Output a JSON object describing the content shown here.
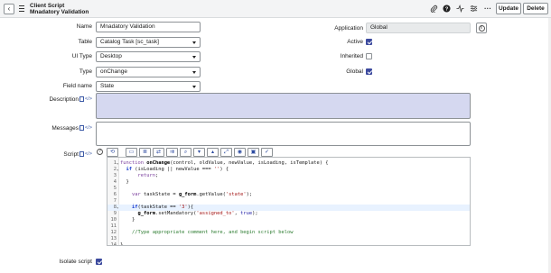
{
  "header": {
    "record_type": "Client Script",
    "record_name": "Mnadatory Validation",
    "icons": [
      "attachment-icon",
      "help-icon",
      "activity-icon",
      "settings-icon",
      "more-icon"
    ],
    "update_label": "Update",
    "delete_label": "Delete"
  },
  "form": {
    "name": {
      "label": "Name",
      "value": "Mnadatory Validation"
    },
    "table": {
      "label": "Table",
      "value": "Catalog Task [sc_task]"
    },
    "ui_type": {
      "label": "UI Type",
      "value": "Desktop"
    },
    "type": {
      "label": "Type",
      "value": "onChange"
    },
    "field_name": {
      "label": "Field name",
      "value": "State"
    },
    "application": {
      "label": "Application",
      "value": "Global"
    },
    "active": {
      "label": "Active",
      "checked": true
    },
    "inherited": {
      "label": "Inherited",
      "checked": false
    },
    "global": {
      "label": "Global",
      "checked": true
    },
    "description": {
      "label": "Description",
      "value": ""
    },
    "messages": {
      "label": "Messages",
      "value": ""
    },
    "script": {
      "label": "Script"
    },
    "isolate_script": {
      "label": "Isolate script",
      "checked": true
    }
  },
  "colors": {
    "accent": "#3c4a9e",
    "highlight_field": "#d5d8f0",
    "header_bg": "#f3f4f5"
  },
  "editor": {
    "toolbar_icons": [
      "comment-icon",
      "format-icon",
      "replace-icon",
      "replace-all-icon",
      "search-icon",
      "toggle-down-icon",
      "toggle-up-icon",
      "fullscreen-icon",
      "globe-icon",
      "save-icon",
      "syntax-check-icon"
    ],
    "lines": [
      {
        "n": "1",
        "fold": "▾",
        "text": "function onChange(control, oldValue, newValue, isLoading, isTemplate) {"
      },
      {
        "n": "2",
        "fold": "▾",
        "text": "  if (isLoading || newValue === '') {"
      },
      {
        "n": "3",
        "fold": "",
        "text": "      return;"
      },
      {
        "n": "4",
        "fold": "",
        "text": "  }"
      },
      {
        "n": "5",
        "fold": "",
        "text": ""
      },
      {
        "n": "6",
        "fold": "",
        "text": "    var taskState = g_form.getValue('state');"
      },
      {
        "n": "7",
        "fold": "",
        "text": ""
      },
      {
        "n": "8",
        "fold": "▾",
        "text": "    if(taskState == '3'){"
      },
      {
        "n": "9",
        "fold": "",
        "text": "      g_form.setMandatory('assigned_to', true);"
      },
      {
        "n": "10",
        "fold": "",
        "text": "    }"
      },
      {
        "n": "11",
        "fold": "",
        "text": ""
      },
      {
        "n": "12",
        "fold": "",
        "text": "    //Type appropriate comment here, and begin script below"
      },
      {
        "n": "13",
        "fold": "",
        "text": ""
      },
      {
        "n": "14",
        "fold": "",
        "text": "}"
      }
    ]
  }
}
